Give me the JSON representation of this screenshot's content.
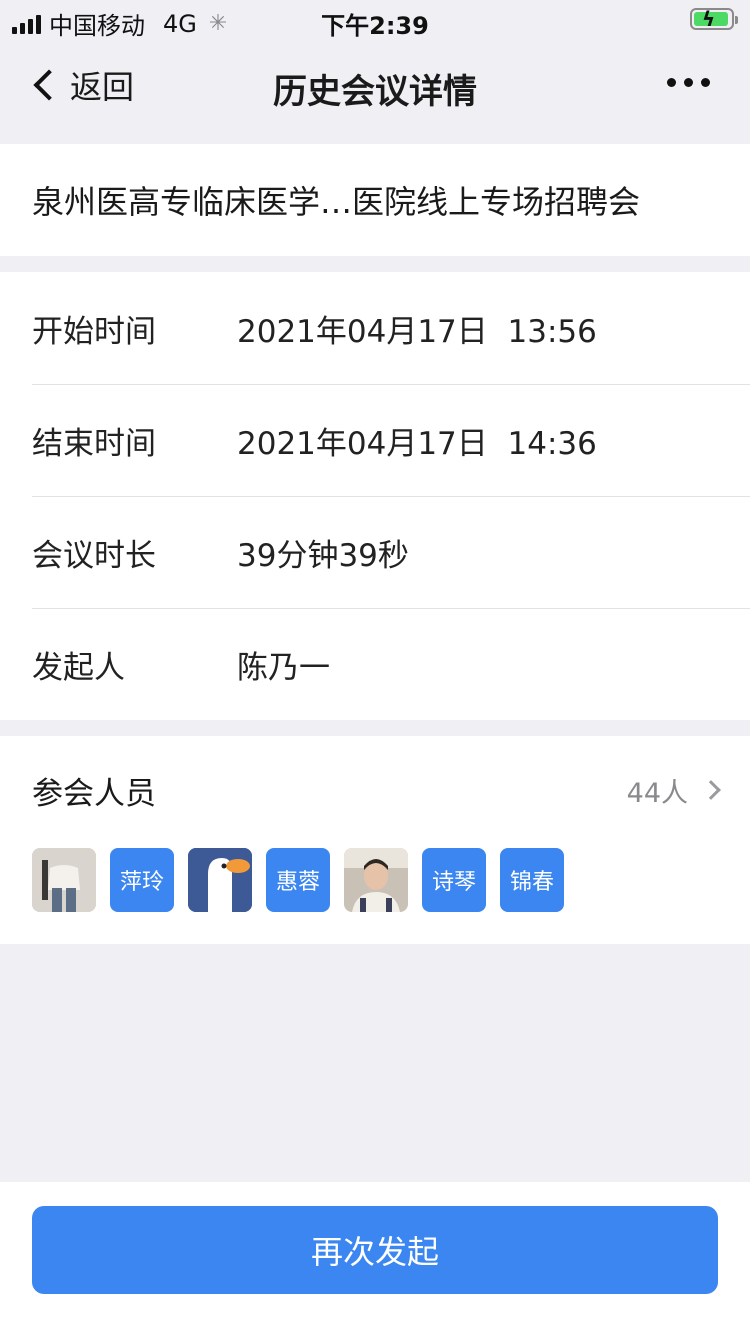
{
  "status_bar": {
    "carrier": "中国移动",
    "network": "4G",
    "time": "下午2:39"
  },
  "nav": {
    "back_label": "返回",
    "title": "历史会议详情"
  },
  "meeting": {
    "title": "泉州医高专临床医学…医院线上专场招聘会"
  },
  "info": {
    "start_label": "开始时间",
    "start_value": "2021年04月17日  13:56",
    "end_label": "结束时间",
    "end_value": "2021年04月17日  14:36",
    "duration_label": "会议时长",
    "duration_value": "39分钟39秒",
    "host_label": "发起人",
    "host_value": "陈乃一"
  },
  "members": {
    "label": "参会人员",
    "count": "44人",
    "avatars": [
      {
        "type": "photo",
        "name": "person-photo"
      },
      {
        "type": "text",
        "text": "萍玲"
      },
      {
        "type": "photo",
        "name": "goose-photo"
      },
      {
        "type": "text",
        "text": "惠蓉"
      },
      {
        "type": "photo",
        "name": "face-photo"
      },
      {
        "type": "text",
        "text": "诗琴"
      },
      {
        "type": "text",
        "text": "锦春"
      }
    ]
  },
  "actions": {
    "restart_label": "再次发起"
  },
  "colors": {
    "accent": "#3b86f0",
    "background": "#efeff4"
  }
}
